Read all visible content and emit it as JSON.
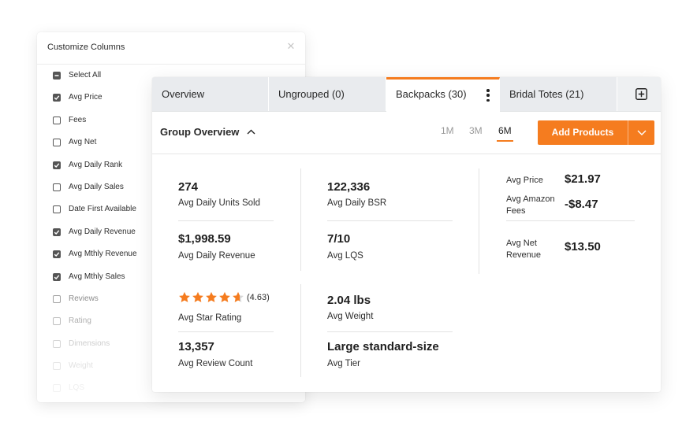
{
  "customize_columns": {
    "title": "Customize Columns",
    "items": [
      {
        "label": "Select All",
        "state": "minus"
      },
      {
        "label": "Avg Price",
        "state": "checked"
      },
      {
        "label": "Fees",
        "state": "unchecked"
      },
      {
        "label": "Avg Net",
        "state": "unchecked"
      },
      {
        "label": "Avg Daily Rank",
        "state": "checked"
      },
      {
        "label": "Avg Daily Sales",
        "state": "unchecked"
      },
      {
        "label": "Date First Available",
        "state": "unchecked"
      },
      {
        "label": "Avg Daily Revenue",
        "state": "checked"
      },
      {
        "label": "Avg Mthly Revenue",
        "state": "checked"
      },
      {
        "label": "Avg Mthly Sales",
        "state": "checked"
      },
      {
        "label": "Reviews",
        "state": "unchecked"
      },
      {
        "label": "Rating",
        "state": "unchecked"
      },
      {
        "label": "Dimensions",
        "state": "unchecked"
      },
      {
        "label": "Weight",
        "state": "unchecked"
      },
      {
        "label": "LQS",
        "state": "unchecked"
      }
    ]
  },
  "tabs": [
    {
      "label": "Overview"
    },
    {
      "label": "Ungrouped (0)"
    },
    {
      "label": "Backpacks (30)",
      "active": true
    },
    {
      "label": "Bridal Totes (21)"
    }
  ],
  "group_overview": {
    "title": "Group Overview",
    "periods": [
      "1M",
      "3M",
      "6M"
    ],
    "active_period": "6M",
    "add_button": "Add Products"
  },
  "stats": {
    "avg_daily_units_sold": {
      "value": "274",
      "label": "Avg Daily Units Sold"
    },
    "avg_daily_revenue": {
      "value": "$1,998.59",
      "label": "Avg Daily Revenue"
    },
    "avg_daily_bsr": {
      "value": "122,336",
      "label": "Avg Daily BSR"
    },
    "avg_lqs": {
      "value": "7/10",
      "label": "Avg LQS"
    },
    "avg_star_rating": {
      "value": 4.63,
      "display": "(4.63)",
      "label": "Avg Star Rating"
    },
    "avg_review_count": {
      "value": "13,357",
      "label": "Avg Review Count"
    },
    "avg_weight": {
      "value": "2.04 lbs",
      "label": "Avg Weight"
    },
    "avg_tier": {
      "value": "Large standard-size",
      "label": "Avg Tier"
    }
  },
  "pricing": {
    "avg_price": {
      "label": "Avg Price",
      "value": "$21.97"
    },
    "avg_amazon_fees": {
      "label_line1": "Avg Amazon",
      "label_line2": "Fees",
      "value": "-$8.47"
    },
    "avg_net_revenue": {
      "label_line1": "Avg Net",
      "label_line2": "Revenue",
      "value": "$13.50"
    }
  },
  "colors": {
    "accent": "#f57c1f",
    "star": "#f57c1f",
    "star_empty": "#d6d6d6"
  },
  "icons": {
    "close": "close-icon",
    "add_tab": "plus-square-icon",
    "tab_menu": "kebab-menu-icon",
    "chevron_up": "chevron-up-icon",
    "chevron_down": "chevron-down-icon",
    "star": "star-icon"
  }
}
